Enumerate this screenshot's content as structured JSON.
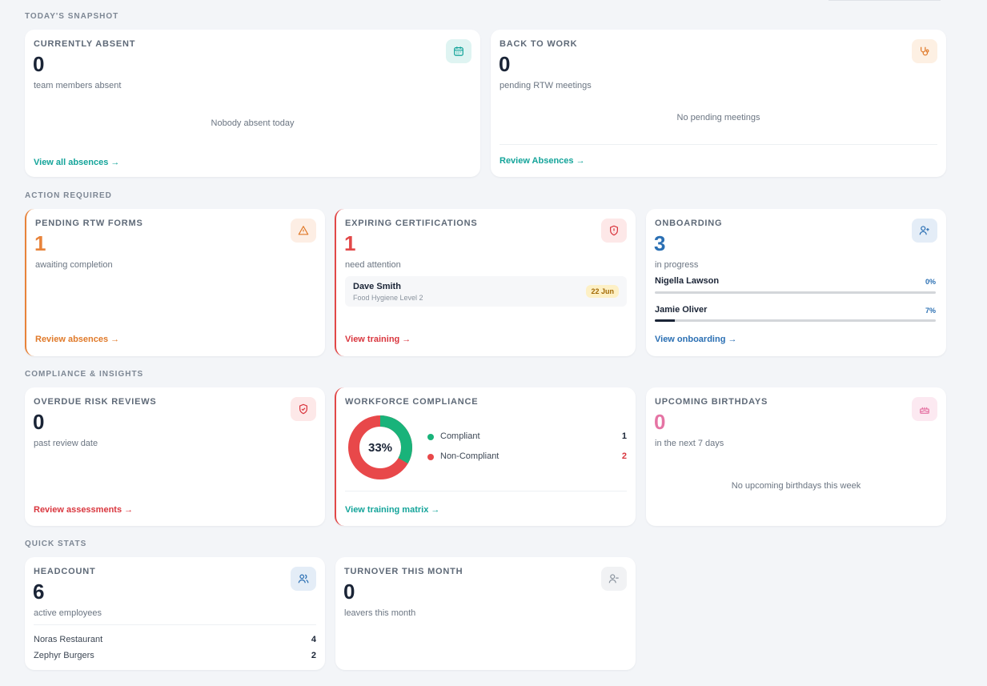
{
  "sections": {
    "snapshot": "TODAY'S SNAPSHOT",
    "action": "ACTION REQUIRED",
    "compliance": "COMPLIANCE & INSIGHTS",
    "quick": "QUICK STATS"
  },
  "absent": {
    "title": "CURRENTLY ABSENT",
    "value": "0",
    "sub": "team members absent",
    "empty": "Nobody absent today",
    "link": "View all absences →",
    "icon": "calendar-icon"
  },
  "rtw": {
    "title": "BACK TO WORK",
    "value": "0",
    "sub": "pending RTW meetings",
    "empty": "No pending meetings",
    "link": "Review Absences →",
    "icon": "stethoscope-icon"
  },
  "rtw_forms": {
    "title": "PENDING RTW FORMS",
    "value": "1",
    "sub": "awaiting completion",
    "link": "Review absences →",
    "icon": "warning-icon"
  },
  "certs": {
    "title": "EXPIRING CERTIFICATIONS",
    "value": "1",
    "sub": "need attention",
    "items": [
      {
        "name": "Dave Smith",
        "course": "Food Hygiene Level 2",
        "date": "22 Jun"
      }
    ],
    "link": "View training →",
    "icon": "shield-alert-icon"
  },
  "onboarding": {
    "title": "ONBOARDING",
    "value": "3",
    "sub": "in progress",
    "people": [
      {
        "name": "Nigella Lawson",
        "pct_label": "0%",
        "progress": 0
      },
      {
        "name": "Jamie Oliver",
        "pct_label": "7%",
        "progress": 7
      }
    ],
    "link": "View onboarding →",
    "icon": "user-plus-icon"
  },
  "risk": {
    "title": "OVERDUE RISK REVIEWS",
    "value": "0",
    "sub": "past review date",
    "link": "Review assessments →",
    "icon": "shield-check-icon"
  },
  "workforce": {
    "title": "WORKFORCE COMPLIANCE",
    "percent_label": "33%",
    "legend": [
      {
        "label": "Compliant",
        "value": "1",
        "color": "#19b37a"
      },
      {
        "label": "Non-Compliant",
        "value": "2",
        "color": "#e8484a"
      }
    ],
    "link": "View training matrix →"
  },
  "birthdays": {
    "title": "UPCOMING BIRTHDAYS",
    "value": "0",
    "sub": "in the next 7 days",
    "empty": "No upcoming birthdays this week",
    "icon": "cake-icon"
  },
  "headcount": {
    "title": "HEADCOUNT",
    "value": "6",
    "sub": "active employees",
    "rows": [
      {
        "name": "Noras Restaurant",
        "count": "4"
      },
      {
        "name": "Zephyr Burgers",
        "count": "2"
      }
    ],
    "icon": "users-icon"
  },
  "turnover": {
    "title": "TURNOVER THIS MONTH",
    "value": "0",
    "sub": "leavers this month",
    "icon": "user-minus-icon"
  },
  "colors": {
    "teal": "#14a49a",
    "orange": "#e07a2a",
    "red": "#d9363e",
    "blue": "#2a6fb3",
    "pink": "#e574a4"
  }
}
